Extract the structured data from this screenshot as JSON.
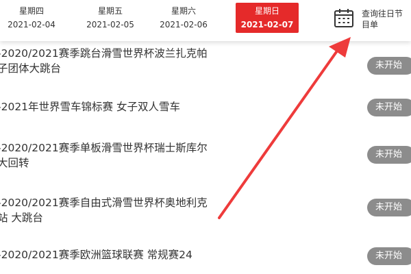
{
  "date_tabs": [
    {
      "weekday": "星期四",
      "date": "2021-02-04",
      "active": false
    },
    {
      "weekday": "星期五",
      "date": "2021-02-05",
      "active": false
    },
    {
      "weekday": "星期六",
      "date": "2021-02-06",
      "active": false
    },
    {
      "weekday": "星期日",
      "date": "2021-02-07",
      "active": true
    }
  ],
  "history_button": {
    "label": "查询往日节目单",
    "icon": "calendar-icon"
  },
  "events": [
    {
      "title": "-2020/2021赛季跳台滑雪世界杯波兰扎克帕\n子团体大跳台",
      "status": "未开始"
    },
    {
      "title": "-2021年世界雪车锦标赛 女子双人雪车",
      "status": "未开始"
    },
    {
      "title": "-2020/2021赛季单板滑雪世界杯瑞士斯库尔\n大回转",
      "status": "未开始"
    },
    {
      "title": "-2020/2021赛季自由式滑雪世界杯奥地利克\n站 大跳台",
      "status": "未开始"
    },
    {
      "title": "-2020/2021赛季欧洲篮球联赛 常规赛24",
      "status": "未开始"
    }
  ],
  "colors": {
    "active_tab": "#e52a2a",
    "badge": "#8c8c8c",
    "arrow": "#ee3b3b",
    "text": "#333333"
  }
}
